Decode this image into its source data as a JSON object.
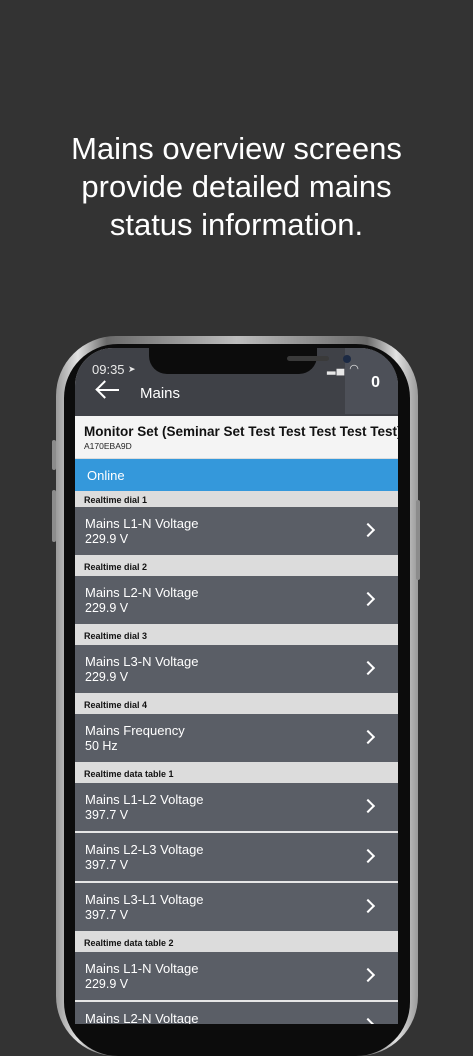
{
  "headline": [
    "Mains overview screens",
    "provide detailed mains",
    "status information."
  ],
  "status_bar": {
    "time": "09:35",
    "location_icon": "location-arrow-icon",
    "icons": "signal-icon wifi-icon battery-icon"
  },
  "header": {
    "title": "Mains",
    "counter": "0",
    "back_icon": "back-arrow-icon"
  },
  "device": {
    "name": "Monitor Set (Seminar Set Test Test Test Test Test)",
    "id": "A170EBA9D"
  },
  "status": {
    "label": "Online",
    "color": "#3498db"
  },
  "sections": [
    {
      "title": "Realtime dial 1",
      "items": [
        {
          "label": "Mains L1-N Voltage",
          "value": "229.9 V"
        }
      ]
    },
    {
      "title": "Realtime dial 2",
      "items": [
        {
          "label": "Mains L2-N Voltage",
          "value": "229.9 V"
        }
      ]
    },
    {
      "title": "Realtime dial 3",
      "items": [
        {
          "label": "Mains L3-N Voltage",
          "value": "229.9 V"
        }
      ]
    },
    {
      "title": "Realtime dial 4",
      "items": [
        {
          "label": "Mains Frequency",
          "value": "50 Hz"
        }
      ]
    },
    {
      "title": "Realtime data table 1",
      "items": [
        {
          "label": "Mains L1-L2 Voltage",
          "value": "397.7 V"
        },
        {
          "label": "Mains L2-L3 Voltage",
          "value": "397.7 V"
        },
        {
          "label": "Mains L3-L1 Voltage",
          "value": "397.7 V"
        }
      ]
    },
    {
      "title": "Realtime data table 2",
      "items": [
        {
          "label": "Mains L1-N Voltage",
          "value": "229.9 V"
        },
        {
          "label": "Mains L2-N Voltage",
          "value": ""
        }
      ]
    }
  ]
}
